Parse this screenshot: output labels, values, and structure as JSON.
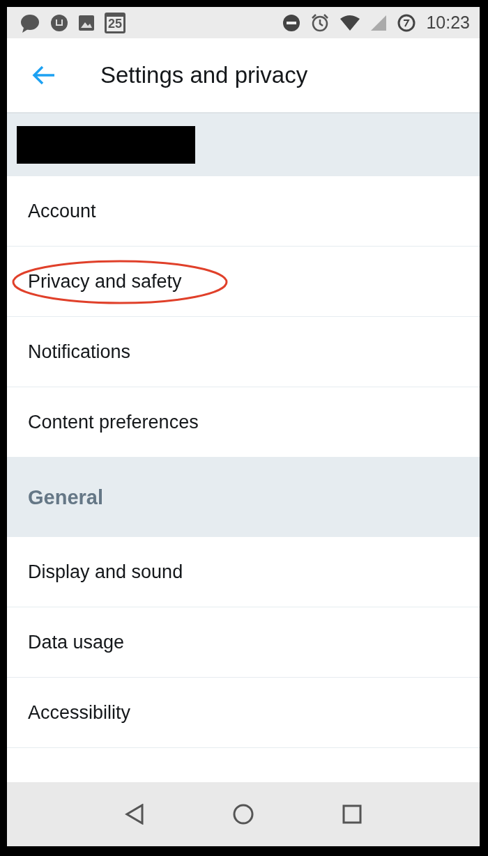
{
  "status_bar": {
    "calendar_day": "25",
    "time": "10:23"
  },
  "app_bar": {
    "title": "Settings and privacy"
  },
  "account_header": {
    "redacted": true
  },
  "sections": [
    {
      "kind": "items",
      "items": [
        {
          "label": "Account",
          "circled": false
        },
        {
          "label": "Privacy and safety",
          "circled": true
        },
        {
          "label": "Notifications",
          "circled": false
        },
        {
          "label": "Content preferences",
          "circled": false
        }
      ]
    },
    {
      "kind": "header",
      "title": "General"
    },
    {
      "kind": "items",
      "items": [
        {
          "label": "Display and sound",
          "circled": false
        },
        {
          "label": "Data usage",
          "circled": false
        },
        {
          "label": "Accessibility",
          "circled": false
        }
      ]
    }
  ]
}
